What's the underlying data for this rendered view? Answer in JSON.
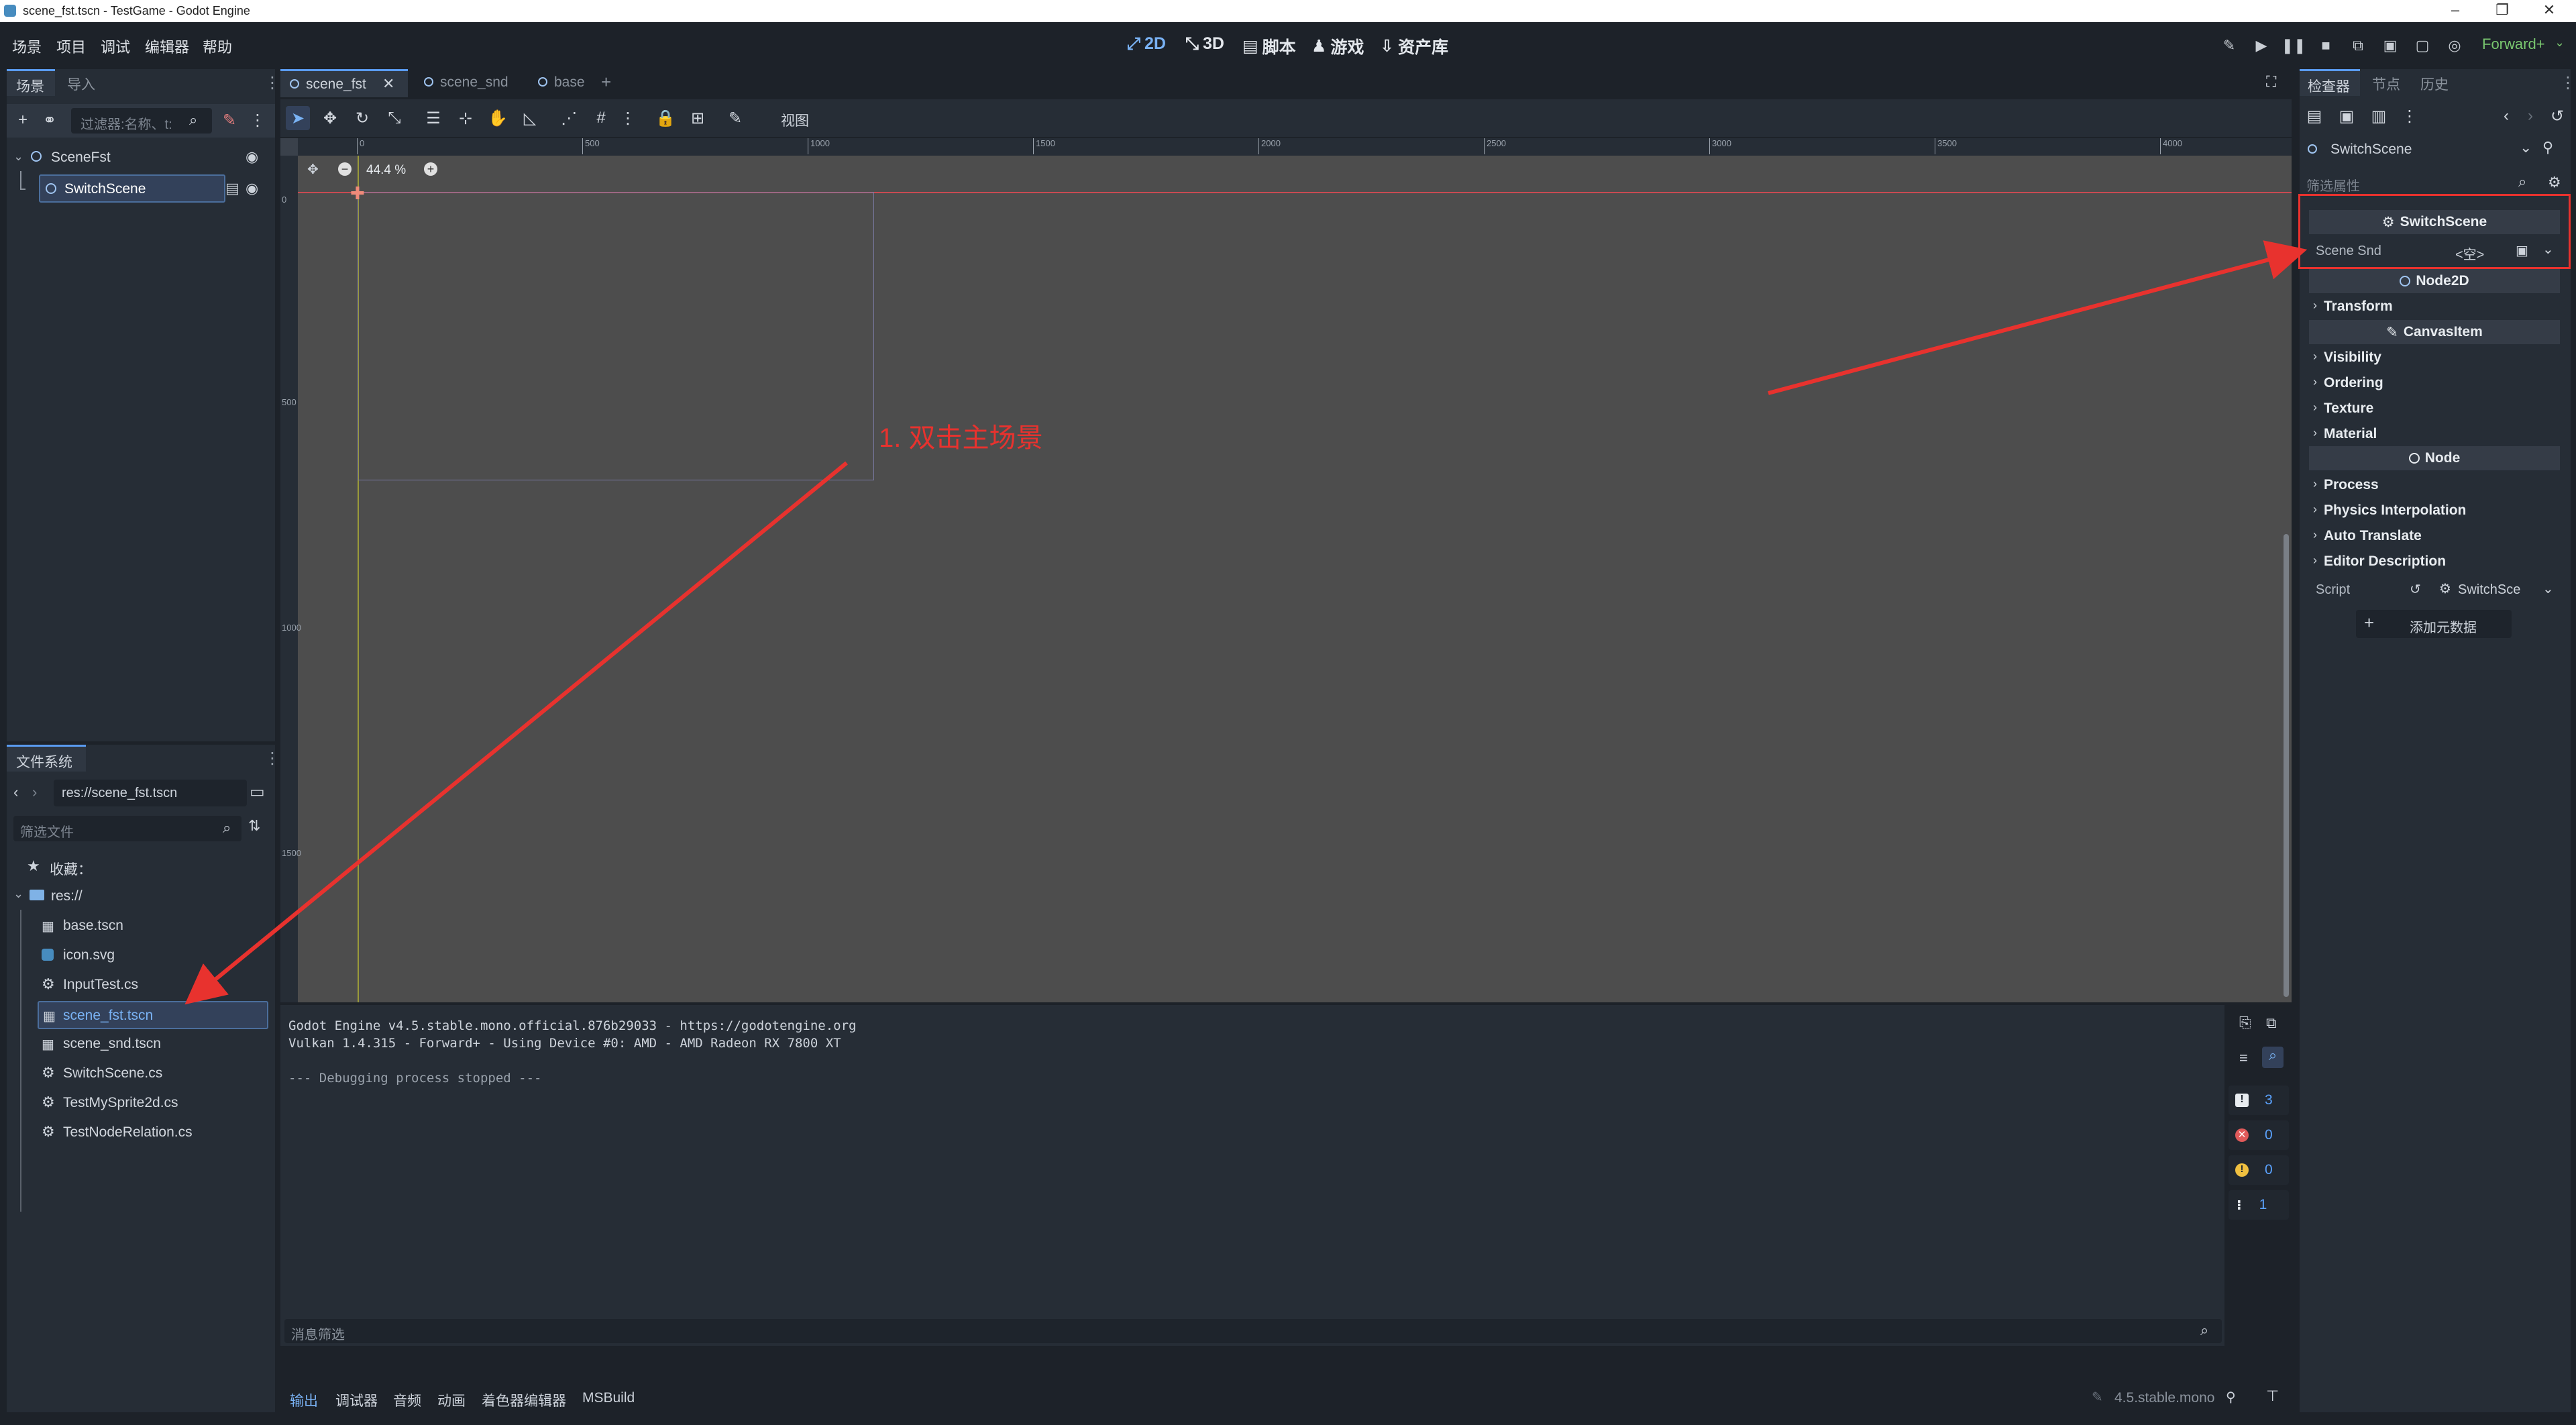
{
  "window": {
    "title": "scene_fst.tscn - TestGame - Godot Engine"
  },
  "menu": [
    "场景",
    "项目",
    "调试",
    "编辑器",
    "帮助"
  ],
  "workspaces": [
    {
      "label": "2D",
      "active": true
    },
    {
      "label": "3D",
      "active": false
    },
    {
      "label": "脚本",
      "active": false
    },
    {
      "label": "游戏",
      "active": false
    },
    {
      "label": "资产库",
      "active": false
    }
  ],
  "renderer": "Forward+",
  "scene_dock": {
    "tabs": [
      "场景",
      "导入"
    ],
    "filter_placeholder": "过滤器:名称、t:",
    "tree": [
      {
        "name": "SceneFst",
        "selected": false
      },
      {
        "name": "SwitchScene",
        "selected": true
      }
    ]
  },
  "filesystem_dock": {
    "tab": "文件系统",
    "path": "res://scene_fst.tscn",
    "filter_placeholder": "筛选文件",
    "favorites": "收藏：",
    "root": "res://",
    "files": [
      {
        "name": "base.tscn",
        "icon": "scene-icon",
        "selected": false
      },
      {
        "name": "icon.svg",
        "icon": "image-icon",
        "selected": false
      },
      {
        "name": "InputTest.cs",
        "icon": "csharp-icon",
        "selected": false
      },
      {
        "name": "scene_fst.tscn",
        "icon": "scene-icon",
        "selected": true
      },
      {
        "name": "scene_snd.tscn",
        "icon": "scene-icon",
        "selected": false
      },
      {
        "name": "SwitchScene.cs",
        "icon": "csharp-icon",
        "selected": false
      },
      {
        "name": "TestMySprite2d.cs",
        "icon": "csharp-icon",
        "selected": false
      },
      {
        "name": "TestNodeRelation.cs",
        "icon": "csharp-icon",
        "selected": false
      }
    ]
  },
  "editor_tabs": [
    {
      "name": "scene_fst",
      "active": true
    },
    {
      "name": "scene_snd",
      "active": false
    },
    {
      "name": "base",
      "active": false
    }
  ],
  "viewport": {
    "view_menu": "视图",
    "zoom": "44.4 %",
    "ruler_ticks": [
      "0",
      "500",
      "1000",
      "1500",
      "2000",
      "2500",
      "3000",
      "3500",
      "4000"
    ],
    "v_ruler_ticks": [
      "0",
      "500",
      "1000",
      "1500"
    ],
    "annotation": "1. 双击主场景",
    "annotation_color": "#e8322e"
  },
  "output": {
    "lines": [
      "Godot Engine v4.5.stable.mono.official.876b29033 - https://godotengine.org",
      "Vulkan 1.4.315 - Forward+ - Using Device #0: AMD - AMD Radeon RX 7800 XT",
      "",
      "--- Debugging process stopped ---"
    ],
    "filter_placeholder": "消息筛选",
    "counts": {
      "messages": "3",
      "errors": "0",
      "warnings": "0",
      "info": "1"
    }
  },
  "bottom_tabs": [
    "输出",
    "调试器",
    "音频",
    "动画",
    "着色器编辑器",
    "MSBuild"
  ],
  "version": "4.5.stable.mono",
  "inspector": {
    "tabs": [
      "检查器",
      "节点",
      "历史"
    ],
    "node_name": "SwitchScene",
    "filter_placeholder": "筛选属性",
    "script_header": "SwitchScene",
    "scene_snd_label": "Scene Snd",
    "scene_snd_value": "<空>",
    "sections": [
      {
        "type": "header",
        "label": "Node2D"
      },
      {
        "type": "group",
        "label": "Transform"
      },
      {
        "type": "header",
        "label": "CanvasItem"
      },
      {
        "type": "group",
        "label": "Visibility"
      },
      {
        "type": "group",
        "label": "Ordering"
      },
      {
        "type": "group",
        "label": "Texture"
      },
      {
        "type": "group",
        "label": "Material"
      },
      {
        "type": "header",
        "label": "Node"
      },
      {
        "type": "group",
        "label": "Process"
      },
      {
        "type": "group",
        "label": "Physics Interpolation"
      },
      {
        "type": "group",
        "label": "Auto Translate"
      },
      {
        "type": "group",
        "label": "Editor Description"
      }
    ],
    "script_label": "Script",
    "script_value": "SwitchSce",
    "add_metadata": "添加元数据"
  },
  "colors": {
    "accent": "#5a9bf0",
    "annotation": "#e8322e",
    "viewport_bg": "#4d4d4d"
  }
}
